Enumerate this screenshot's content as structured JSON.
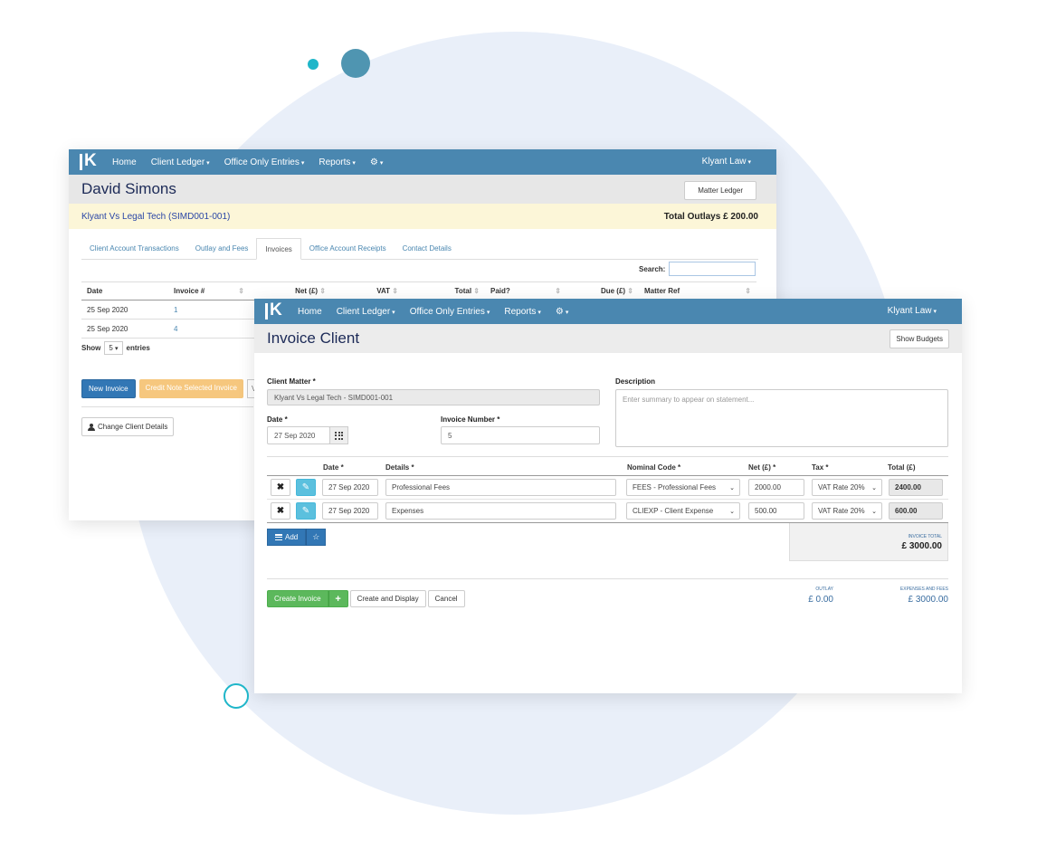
{
  "nav": {
    "items": [
      "Home",
      "Client Ledger",
      "Office Only Entries",
      "Reports"
    ],
    "firm": "Klyant Law"
  },
  "back": {
    "client_name": "David Simons",
    "matter_ledger_btn": "Matter Ledger",
    "matter": "Klyant Vs Legal Tech (SIMD001-001)",
    "total_outlays": "Total Outlays £ 200.00",
    "tabs": [
      "Client Account Transactions",
      "Outlay and Fees",
      "Invoices",
      "Office Account Receipts",
      "Contact Details"
    ],
    "search_label": "Search:",
    "columns": [
      "Date",
      "Invoice #",
      "Net (£)",
      "VAT",
      "Total",
      "Paid?",
      "Due (£)",
      "Matter Ref"
    ],
    "rows": [
      {
        "date": "25 Sep 2020",
        "invoice": "1"
      },
      {
        "date": "25 Sep 2020",
        "invoice": "4"
      }
    ],
    "show_label": "Show",
    "show_value": "5",
    "entries_label": "entries",
    "new_invoice": "New Invoice",
    "credit_note": "Credit Note Selected Invoice",
    "partial_btn": "V",
    "change_client": "Change Client Details"
  },
  "front": {
    "title": "Invoice Client",
    "show_budgets": "Show Budgets",
    "client_matter_label": "Client Matter *",
    "client_matter_value": "Klyant Vs Legal Tech - SIMD001-001",
    "description_label": "Description",
    "description_placeholder": "Enter summary to appear on statement...",
    "date_label": "Date *",
    "date_value": "27 Sep 2020",
    "invoice_number_label": "Invoice Number *",
    "invoice_number_value": "5",
    "line_columns": {
      "date": "Date *",
      "details": "Details *",
      "nominal": "Nominal Code *",
      "net": "Net (£) *",
      "tax": "Tax *",
      "total": "Total (£)"
    },
    "lines": [
      {
        "date": "27 Sep 2020",
        "details": "Professional Fees",
        "nominal": "FEES - Professional Fees",
        "net": "2000.00",
        "tax": "VAT Rate 20%",
        "total": "2400.00"
      },
      {
        "date": "27 Sep 2020",
        "details": "Expenses",
        "nominal": "CLIEXP - Client Expense",
        "net": "500.00",
        "tax": "VAT Rate 20%",
        "total": "600.00"
      }
    ],
    "add_btn": "Add",
    "invoice_total_label": "INVOICE TOTAL",
    "invoice_total_value": "£ 3000.00",
    "create_invoice": "Create Invoice",
    "create_display": "Create and Display",
    "cancel": "Cancel",
    "outlay_label": "OUTLAY",
    "outlay_value": "£ 0.00",
    "expenses_label": "EXPENSES AND FEES",
    "expenses_value": "£ 3000.00"
  },
  "colors": {
    "nav": "#4a87b0",
    "primary": "#3277b5",
    "success": "#5cb85c",
    "info": "#5bc0de",
    "warning": "#f6c77e",
    "background_circle": "#e9eff9",
    "accent_teal": "#1fb6c9"
  },
  "icons": [
    "klyant-logo",
    "gear-icon",
    "calendar-icon",
    "close-icon",
    "edit-icon",
    "list-icon",
    "star-icon",
    "plus-icon",
    "user-icon",
    "sort-icon"
  ]
}
